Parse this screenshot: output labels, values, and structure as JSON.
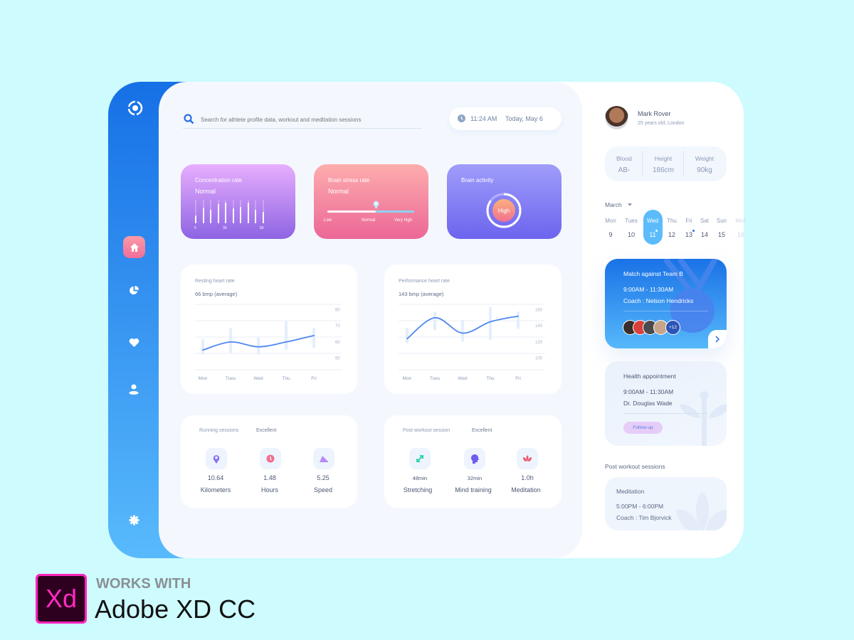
{
  "search": {
    "placeholder": "Search for athlete profile data, workout and meditation sessions",
    "icon": "search-icon"
  },
  "clock": {
    "time": "11:24 AM",
    "date": "Today, May 6"
  },
  "sidebar": {
    "items": [
      {
        "name": "home",
        "icon": "home-icon",
        "active": true
      },
      {
        "name": "stats",
        "icon": "pie-chart-icon"
      },
      {
        "name": "health",
        "icon": "heart-icon"
      },
      {
        "name": "profile",
        "icon": "user-icon"
      },
      {
        "name": "settings",
        "icon": "gear-icon"
      }
    ],
    "active_color": "#f27a9e"
  },
  "concentration": {
    "title": "Concentration rate",
    "value": "Normal",
    "bars": [
      0.32,
      0.67,
      0.59,
      0.81,
      0.88,
      0.63,
      0.71,
      0.88,
      0.57,
      0.5
    ],
    "axis": [
      "0",
      "30",
      "60"
    ]
  },
  "stress": {
    "title": "Brain stress rate",
    "value": "Normal",
    "level": 0.56,
    "labels": [
      "Low",
      "Normal",
      "Very high"
    ]
  },
  "brain": {
    "title": "Brain activity",
    "value": "High",
    "level": 0.85
  },
  "chart_data": [
    {
      "type": "line",
      "title": "Resting heart rate",
      "subtitle": "66 bmp (average)",
      "categories": [
        "Mon",
        "Tues",
        "Wed",
        "Thu",
        "Fri"
      ],
      "values": [
        55,
        60,
        57,
        60,
        64
      ],
      "ranges": [
        [
          53,
          61
        ],
        [
          54,
          68
        ],
        [
          53,
          62
        ],
        [
          56,
          72
        ],
        [
          57,
          68
        ]
      ],
      "yticks": [
        "80",
        "70",
        "60",
        "50"
      ],
      "ylim": [
        45,
        85
      ],
      "grid": true
    },
    {
      "type": "line",
      "title": "Performance heart rate",
      "subtitle": "143 bmp (average)",
      "categories": [
        "Mon",
        "Tues",
        "Wed",
        "Thu",
        "Fri"
      ],
      "values": [
        124,
        150,
        131,
        145,
        152
      ],
      "ranges": [
        [
          120,
          136
        ],
        [
          136,
          156
        ],
        [
          122,
          146
        ],
        [
          124,
          162
        ],
        [
          138,
          156
        ]
      ],
      "yticks": [
        "160",
        "140",
        "120",
        "100"
      ],
      "ylim": [
        90,
        170
      ],
      "grid": true
    }
  ],
  "running": {
    "title": "Running sessions",
    "rating": "Excellent",
    "items": [
      {
        "value": "10.64",
        "label": "Kilometers",
        "icon": "location-pin-icon"
      },
      {
        "value": "1.48",
        "label": "Hours",
        "icon": "clock-icon"
      },
      {
        "value": "5.25",
        "label": "Speed",
        "icon": "shoe-icon"
      }
    ]
  },
  "post": {
    "title": "Post workout session",
    "rating": "Excellent",
    "items": [
      {
        "value": "48min",
        "label": "Stretching",
        "icon": "expand-arrows-icon"
      },
      {
        "value": "32min",
        "label": "Mind training",
        "icon": "head-icon"
      },
      {
        "value": "1.0h",
        "label": "Meditation",
        "icon": "lotus-icon"
      }
    ]
  },
  "profile": {
    "name": "Mark Rover",
    "info": "25 years old, London",
    "stats": [
      {
        "label": "Blood",
        "value": "AB-"
      },
      {
        "label": "Height",
        "value": "186cm"
      },
      {
        "label": "Weight",
        "value": "90kg"
      }
    ]
  },
  "calendar": {
    "month": "March",
    "days": [
      {
        "d": "Mon",
        "n": "9"
      },
      {
        "d": "Tues",
        "n": "10"
      },
      {
        "d": "Wed",
        "n": "11",
        "selected": true
      },
      {
        "d": "Thu",
        "n": "12"
      },
      {
        "d": "Fri",
        "n": "13"
      },
      {
        "d": "Sat",
        "n": "14"
      },
      {
        "d": "Sun",
        "n": "15"
      },
      {
        "d": "Mon",
        "n": "16"
      }
    ]
  },
  "match": {
    "title": "Match against Team B",
    "time": "9:00AM - 11:30AM",
    "coach": "Coach : Nelson Hendricks",
    "more": "+12"
  },
  "appointment": {
    "title": "Health appointment",
    "time": "9:00AM - 11:30AM",
    "doctor": "Dr. Douglas Wade",
    "tag": "Follow-up"
  },
  "sessions": {
    "heading": "Post workout sessions",
    "title": "Meditation",
    "time": "5:00PM - 6:00PM",
    "coach": "Coach : Tim Bjorvick"
  },
  "promo": {
    "logo": "Xd",
    "line1": "WORKS WITH",
    "line2": "Adobe XD CC"
  }
}
